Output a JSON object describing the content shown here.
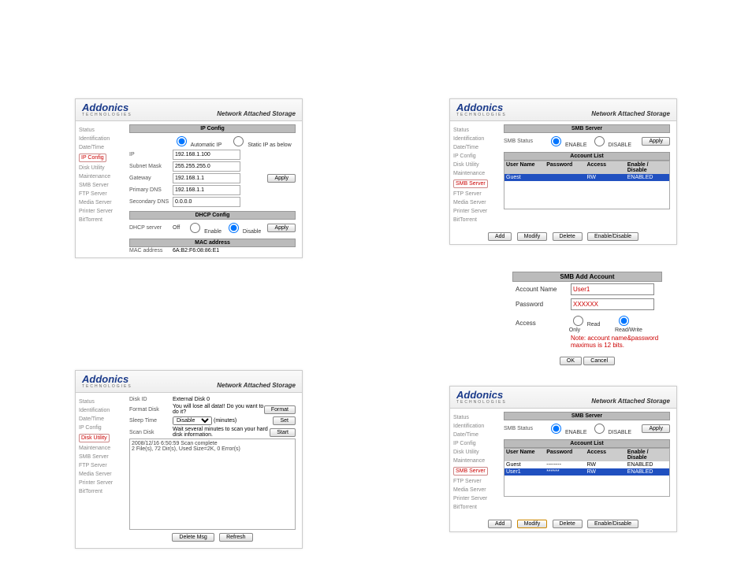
{
  "brand": "Addonics",
  "brand_sub": "TECHNOLOGIES",
  "tagline": "Network Attached Storage",
  "sidebar": {
    "status": "Status",
    "identification": "Identification",
    "datetime": "Date/Time",
    "ipconfig": "IP Config",
    "diskutility": "Disk Utility",
    "maintenance": "Maintenance",
    "smbserver": "SMB Server",
    "ftpserver": "FTP Server",
    "mediaserver": "Media Server",
    "printerserver": "Printer Server",
    "bittorrent": "BitTorrent"
  },
  "ipconfig": {
    "section1": "IP Config",
    "auto_ip": "Automatic IP",
    "static_ip": "Static IP as below",
    "ip_lbl": "IP",
    "ip_val": "192.168.1.100",
    "subnet_lbl": "Subnet Mask",
    "subnet_val": "255.255.255.0",
    "gateway_lbl": "Gateway",
    "gateway_val": "192.168.1.1",
    "pdns_lbl": "Primary DNS",
    "pdns_val": "192.168.1.1",
    "sdns_lbl": "Secondary DNS",
    "sdns_val": "0.0.0.0",
    "apply": "Apply",
    "section2": "DHCP Config",
    "dhcp_lbl": "DHCP server",
    "off": "Off",
    "enable": "Enable",
    "disable": "Disable",
    "section3": "MAC address",
    "mac_lbl": "MAC address",
    "mac_val": "6A:B2:F6:08:86:E1"
  },
  "smb": {
    "section": "SMB Server",
    "status_lbl": "SMB Status",
    "enable": "ENABLE",
    "disable": "DISABLE",
    "apply": "Apply",
    "list_header": "Account List",
    "col_user": "User Name",
    "col_pass": "Password",
    "col_access": "Access",
    "col_ed": "Enable / Disable",
    "rows1": [
      {
        "user": "Guest",
        "pass": "",
        "access": "RW",
        "ed": "ENABLED"
      }
    ],
    "rows2": [
      {
        "user": "Guest",
        "pass": "--------",
        "access": "RW",
        "ed": "ENABLED"
      },
      {
        "user": "User1",
        "pass": "******",
        "access": "RW",
        "ed": "ENABLED"
      }
    ],
    "btn_add": "Add",
    "btn_modify": "Modify",
    "btn_delete": "Delete",
    "btn_ed": "Enable/Disable"
  },
  "addaccount": {
    "title": "SMB Add Account",
    "name_lbl": "Account Name",
    "name_val": "User1",
    "pass_lbl": "Password",
    "pass_val": "XXXXXX",
    "access_lbl": "Access",
    "readonly": "Read Only",
    "readwrite": "Read/Write",
    "note1": "Note: account name&password",
    "note2": "maximus is 12 bits.",
    "ok": "OK",
    "cancel": "Cancel"
  },
  "disk": {
    "diskid_lbl": "Disk ID",
    "diskid_val": "External Disk 0",
    "format_lbl": "Format Disk",
    "format_val": "You will lose all data!! Do you want to do it?",
    "format_btn": "Format",
    "sleep_lbl": "Sleep Time",
    "sleep_val": "Disable",
    "sleep_unit": "(minutes)",
    "set_btn": "Set",
    "scan_lbl": "Scan Disk",
    "scan_val": "Wait several minutes to scan your hard disk information.",
    "start_btn": "Start",
    "log1": "2008/12/16  6:50:59 Scan complete",
    "log2": "2 File(s), 72 Dir(s), Used Size=2K, 0 Error(s)",
    "delmsg": "Delete Msg",
    "refresh": "Refresh"
  }
}
